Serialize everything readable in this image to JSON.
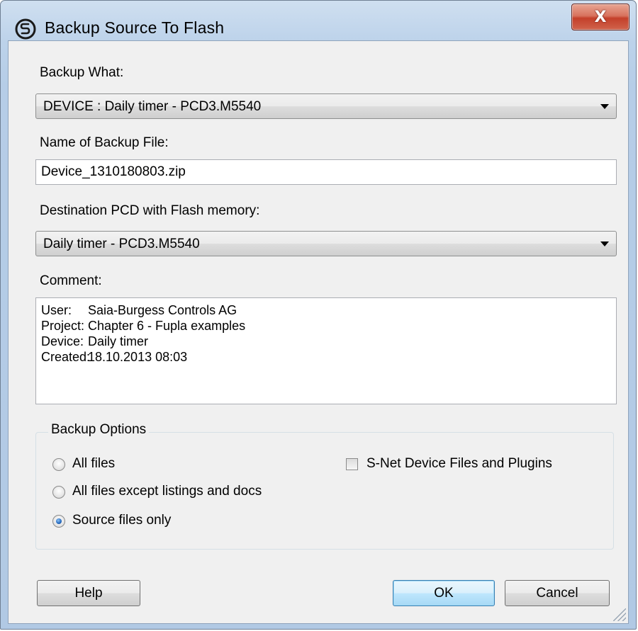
{
  "window": {
    "title": "Backup Source To Flash",
    "close_symbol": "X",
    "app_icon": "saia-s-icon",
    "close_icon": "close-icon"
  },
  "backup_what": {
    "label": "Backup What:",
    "value": "DEVICE : Daily timer - PCD3.M5540"
  },
  "backup_file": {
    "label": "Name of Backup File:",
    "value": "Device_1310180803.zip"
  },
  "destination": {
    "label": "Destination PCD with Flash memory:",
    "value": "Daily timer - PCD3.M5540"
  },
  "comment": {
    "label": "Comment:",
    "lines": [
      {
        "key": "User:",
        "value": "Saia-Burgess Controls AG"
      },
      {
        "key": "Project:",
        "value": "Chapter 6 - Fupla examples"
      },
      {
        "key": "Device:",
        "value": "Daily timer"
      },
      {
        "key": "Created:",
        "value": "18.10.2013 08:03"
      }
    ]
  },
  "options": {
    "title": "Backup Options",
    "radios": [
      {
        "label": "All files",
        "checked": false
      },
      {
        "label": "All files except listings and docs",
        "checked": false
      },
      {
        "label": "Source files only",
        "checked": true
      }
    ],
    "checkbox": {
      "label": "S-Net Device Files and Plugins",
      "checked": false
    }
  },
  "buttons": {
    "help": "Help",
    "ok": "OK",
    "cancel": "Cancel"
  },
  "colors": {
    "frame": "#b6cde7",
    "client": "#f0f0f0",
    "close_red": "#c4402a",
    "default_button_border": "#3c7fb1"
  }
}
